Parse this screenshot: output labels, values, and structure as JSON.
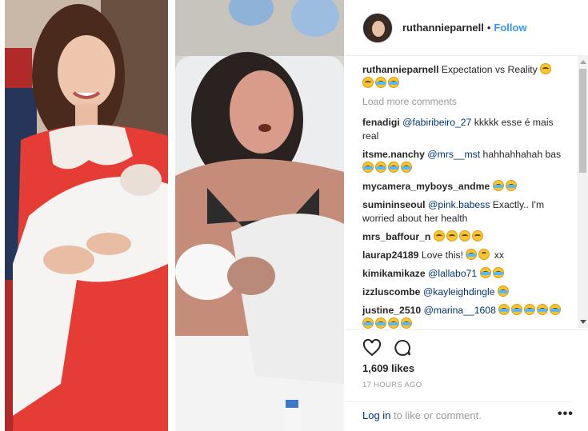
{
  "post": {
    "username": "ruthannieparnell",
    "separator": "•",
    "follow_label": "Follow",
    "caption_text": "Expectation vs Reality",
    "load_more_label": "Load more comments",
    "likes": "1,609 likes",
    "timestamp": "17 HOURS AGO",
    "login_link": "Log in",
    "login_suffix": " to like or comment.",
    "more_label": "•••"
  },
  "comments": [
    {
      "user": "fenadigi",
      "mention": "@fabiribeiro_27",
      "text": " kkkkk esse é mais real",
      "emojis": []
    },
    {
      "user": "itsme.nanchy",
      "mention": "@mrs__mst",
      "text": " hahhahhahah bas ",
      "emojis": [
        "tears",
        "tears",
        "tears",
        "tears"
      ]
    },
    {
      "user": "mycamera_myboys_andme",
      "mention": "",
      "text": "",
      "emojis": [
        "tears",
        "tears"
      ]
    },
    {
      "user": "sumininseoul",
      "mention": "@pink.babess",
      "text": " Exactly.. I'm worried about her health",
      "emojis": []
    },
    {
      "user": "mrs_baffour_n",
      "mention": "",
      "text": "",
      "emojis": [
        "hand",
        "hand",
        "hand",
        "hand"
      ]
    },
    {
      "user": "laurap24189",
      "mention": "",
      "text": "Love this! ",
      "emojis": [
        "tears",
        "kiss"
      ],
      "suffix": " xx"
    },
    {
      "user": "kimikamikaze",
      "mention": "@lallabo71",
      "text": " ",
      "emojis": [
        "tears",
        "tears"
      ]
    },
    {
      "user": "izzluscombe",
      "mention": "@kayleighdingle",
      "text": " ",
      "emojis": [
        "tears"
      ]
    },
    {
      "user": "justine_2510",
      "mention": "@marina__1608",
      "text": " ",
      "emojis": [
        "tears",
        "tears",
        "tears",
        "tears",
        "tears",
        "tears",
        "tears",
        "tears",
        "tears"
      ]
    }
  ],
  "icons": {
    "heart": "heart-icon",
    "comment": "comment-icon"
  },
  "colors": {
    "link": "#3897f0",
    "mention": "#003569",
    "muted": "#999999",
    "dress": "#e53c35"
  }
}
